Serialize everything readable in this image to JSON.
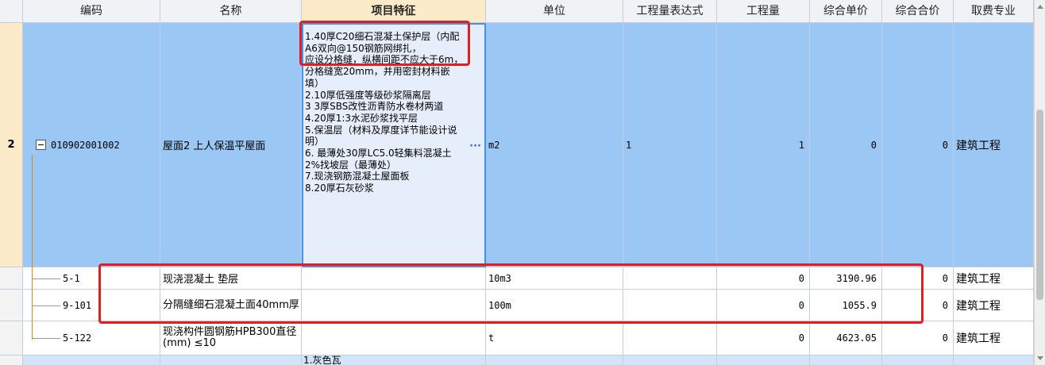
{
  "header": {
    "col_code": "编码",
    "col_name": "名称",
    "col_feature": "项目特征",
    "col_unit": "单位",
    "col_expr": "工程量表达式",
    "col_qty": "工程量",
    "col_unit_price": "综合单价",
    "col_total": "综合合价",
    "col_specialty": "取费专业"
  },
  "main_row": {
    "row_number": "2",
    "code": "010902001002",
    "name": "屋面2 上人保温平屋面",
    "feature": "1.40厚C20细石混凝土保护层（内配A6双向@150钢筋网绑扎，\n应设分格缝，纵横间距不应大于6m，分格缝宽20mm，并用密封材料嵌填）\n2.10厚低强度等级砂浆隔离层\n3 3厚SBS改性沥青防水卷材两道\n4.20厚1:3水泥砂浆找平层\n5.保温层（材料及厚度详节能设计说明）\n6. 最薄处30厚LC5.0轻集料混凝土2%找坡层（最薄处）\n7.现浇钢筋混凝土屋面板\n8.20厚石灰砂浆",
    "ellipsis": "···",
    "unit": "m2",
    "expr": "1",
    "qty": "1",
    "unit_price": "0",
    "total": "0",
    "specialty": "建筑工程"
  },
  "sub_rows": [
    {
      "code": "5-1",
      "name": "现浇混凝土 垫层",
      "unit": "10m3",
      "qty": "0",
      "unit_price": "3190.96",
      "total": "0",
      "specialty": "建筑工程"
    },
    {
      "code": "9-101",
      "name": "分隔缝细石混凝土面40mm厚",
      "unit": "100m",
      "qty": "0",
      "unit_price": "1055.9",
      "total": "0",
      "specialty": "建筑工程"
    },
    {
      "code": "5-122",
      "name": "现浇构件圆钢筋HPB300直径(mm) ≤10",
      "unit": "t",
      "qty": "0",
      "unit_price": "4623.05",
      "total": "0",
      "specialty": "建筑工程"
    }
  ],
  "next_row": {
    "feature_partial": "1.灰色瓦"
  },
  "colors": {
    "highlight": "#e02020",
    "selected_row": "#9bc7f5",
    "feature_col": "#fcebc9",
    "active_cell_border": "#4a90e2"
  }
}
